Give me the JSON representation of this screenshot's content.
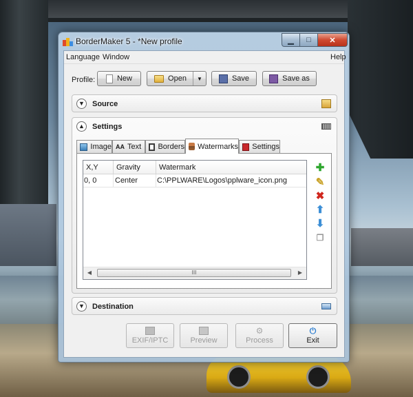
{
  "window": {
    "title": "BorderMaker 5 - *New profile"
  },
  "menu": {
    "items": [
      "Language",
      "Window"
    ],
    "help": "Help"
  },
  "profile": {
    "label": "Profile:",
    "new_label": "New",
    "open_label": "Open",
    "save_label": "Save",
    "save_as_label": "Save as"
  },
  "panels": {
    "source": "Source",
    "settings": "Settings",
    "destination": "Destination"
  },
  "tabs": [
    {
      "label": "Image",
      "icon": "image-icon"
    },
    {
      "label": "Text",
      "prefix": "AA",
      "icon": "text-icon"
    },
    {
      "label": "Borders",
      "icon": "borders-icon"
    },
    {
      "label": "Watermarks",
      "icon": "watermark-stamp-icon",
      "active": true
    },
    {
      "label": "Settings",
      "icon": "toolbox-icon"
    }
  ],
  "watermarks": {
    "columns": [
      "X,Y",
      "Gravity",
      "Watermark"
    ],
    "rows": [
      {
        "xy": "0, 0",
        "gravity": "Center",
        "watermark": "C:\\PPLWARE\\Logos\\pplware_icon.png"
      }
    ],
    "scroll_grip": "III",
    "tools": [
      "add-icon",
      "edit-pencil-icon",
      "delete-icon",
      "move-up-icon",
      "move-down-icon",
      "copy-icon"
    ]
  },
  "bottom_buttons": {
    "exif": "EXIF/IPTC",
    "preview": "Preview",
    "process": "Process",
    "exit": "Exit"
  },
  "colors": {
    "add": "#2ea62e",
    "delete": "#d0271e",
    "arrow": "#3d8fd6",
    "exit_icon": "#2f7fd1"
  }
}
